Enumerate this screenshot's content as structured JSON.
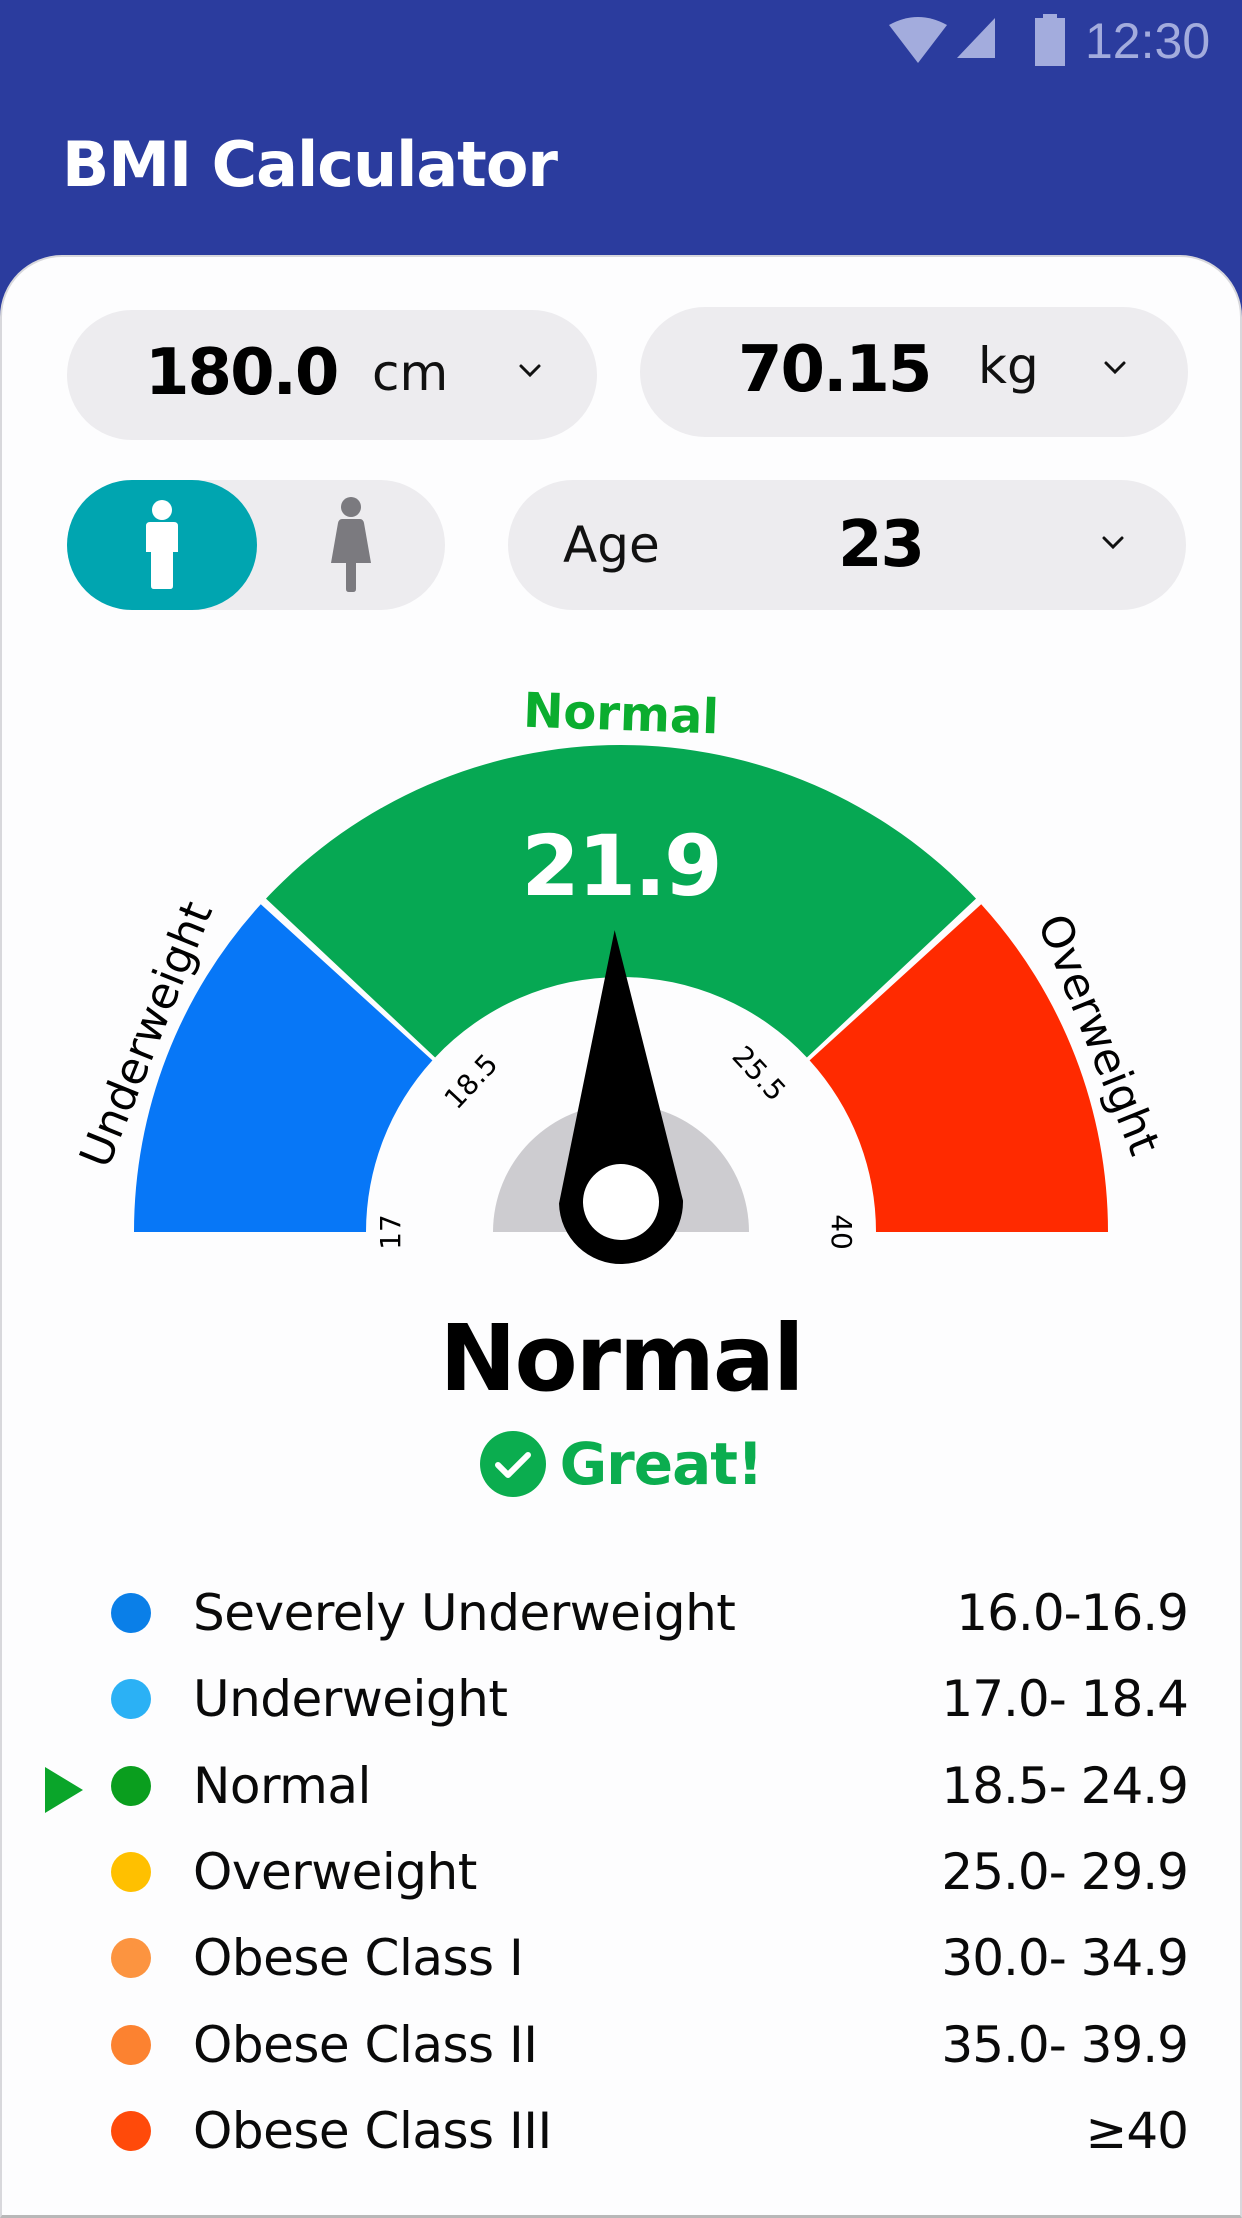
{
  "status_bar": {
    "time": "12:30",
    "icons": [
      "wifi-icon",
      "cell-signal-icon",
      "battery-icon"
    ]
  },
  "app": {
    "title": "BMI Calculator"
  },
  "inputs": {
    "height": {
      "value": "180.0",
      "unit": "cm",
      "icon": "chevron-down-icon"
    },
    "weight": {
      "value": "70.15",
      "unit": "kg",
      "icon": "chevron-down-icon"
    },
    "gender": {
      "options": [
        "male",
        "female"
      ],
      "selected": "male",
      "icons": [
        "male-icon",
        "female-icon"
      ]
    },
    "age": {
      "label": "Age",
      "value": "23",
      "icon": "chevron-down-icon"
    }
  },
  "gauge": {
    "top_label": "Normal",
    "left_label": "Underweight",
    "right_label": "Overweight",
    "value_text": "21.9",
    "value": 21.9,
    "ticks": [
      "17",
      "18.5",
      "25.5",
      "40"
    ],
    "segments": [
      {
        "name": "Underweight",
        "from": 17,
        "to": 18.5,
        "color": "#0777F7"
      },
      {
        "name": "Normal",
        "from": 18.5,
        "to": 25.5,
        "color": "#06A853"
      },
      {
        "name": "Overweight",
        "from": 25.5,
        "to": 40,
        "color": "#FF2A00"
      }
    ],
    "colors": {
      "hub": "#CDCCD0",
      "needle": "#000000",
      "top_label": "#0BAD2F"
    }
  },
  "result": {
    "category": "Normal",
    "message": "Great!",
    "icon": "check-circle-icon",
    "color": "#0BAD4F"
  },
  "bmi_table": {
    "current_index": 2,
    "pointer_icon": "triangle-right-icon",
    "rows": [
      {
        "label": "Severely Underweight",
        "range": "16.0-16.9",
        "color": "#0A7FE8"
      },
      {
        "label": "Underweight",
        "range": "17.0- 18.4",
        "color": "#2BB1F5"
      },
      {
        "label": "Normal",
        "range": "18.5- 24.9",
        "color": "#0A9E1E"
      },
      {
        "label": "Overweight",
        "range": "25.0- 29.9",
        "color": "#FFC000"
      },
      {
        "label": "Obese Class I",
        "range": "30.0- 34.9",
        "color": "#FC9440"
      },
      {
        "label": "Obese Class II",
        "range": "35.0- 39.9",
        "color": "#FC8230"
      },
      {
        "label": "Obese Class III",
        "range": "≥40",
        "color": "#FF4A0A"
      }
    ]
  },
  "colors": {
    "header_bg": "#2B3C9E",
    "accent_teal": "#00A5B0",
    "pill_bg": "#EDECEF"
  }
}
